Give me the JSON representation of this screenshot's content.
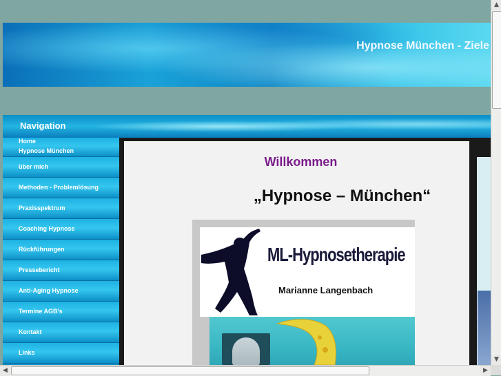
{
  "header": {
    "title": "Hypnose München - Ziele"
  },
  "nav": {
    "title": "Navigation",
    "items": [
      "Home",
      "Hypnose München",
      "über mich",
      "Methoden - Problemlösung",
      "Praxisspektrum",
      "Coaching Hypnose",
      "Rückführungen",
      "Pressebericht",
      "Anti-Aging Hypnose",
      "Termine AGB's",
      "Kontakt",
      "Links"
    ]
  },
  "content": {
    "welcome": "Willkommen",
    "headline": "„Hypnose – München“",
    "logo_title": "ML-Hypnosetherapie",
    "logo_subtitle": "Marianne Langenbach"
  },
  "colors": {
    "background": "#7fa6a0",
    "welcome_text": "#7a1a8a",
    "nav_blue": "#1eb2e4"
  },
  "icons": [
    "scroll-up-icon",
    "scroll-down-icon",
    "scroll-left-icon",
    "scroll-right-icon"
  ]
}
